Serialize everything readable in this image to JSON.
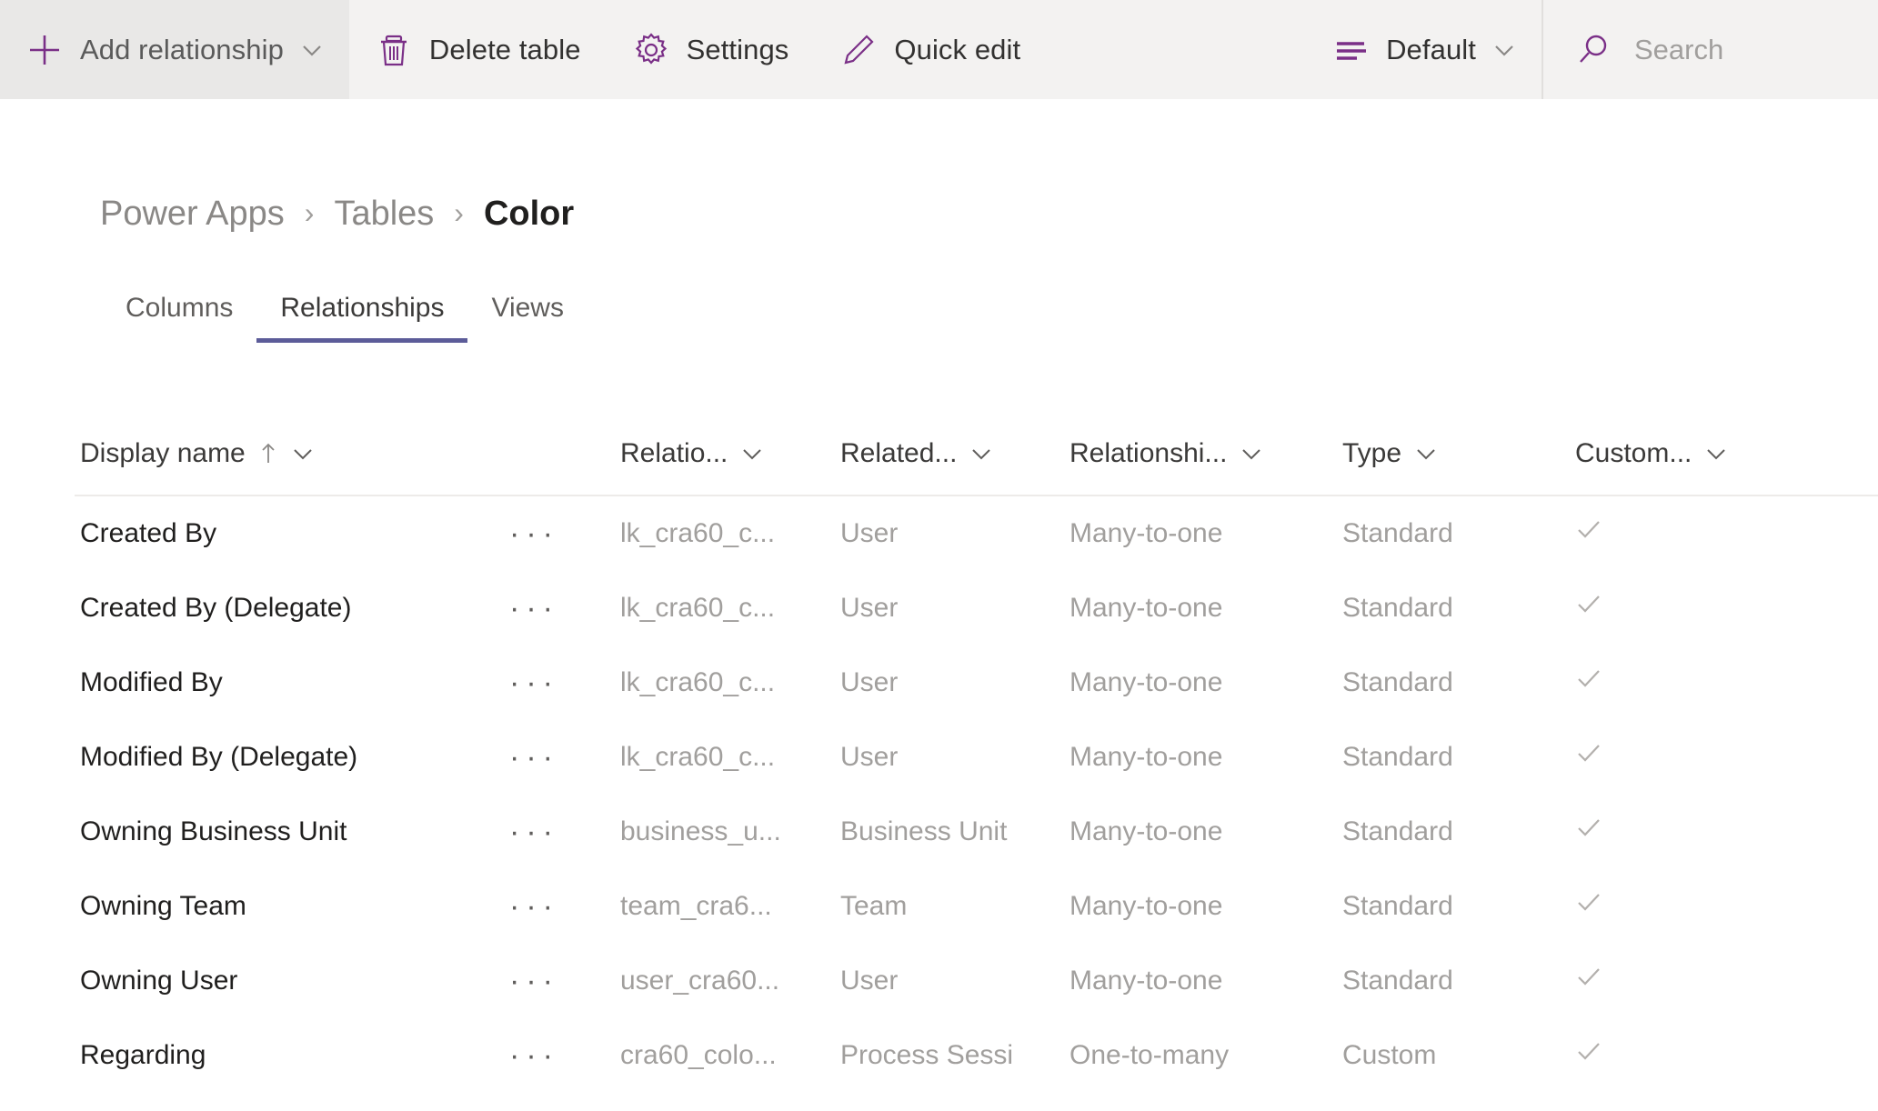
{
  "colors": {
    "brand_purple": "#7a2f87",
    "tab_underline": "#5c5c99",
    "commandbar_bg": "#f3f2f1",
    "highlight_bg": "#e9e8e7",
    "text_primary": "#201f1e",
    "text_dim": "#a19f9d"
  },
  "commandbar": {
    "add_relationship": {
      "label": "Add relationship",
      "icon": "plus-icon",
      "chevron": "chevron-down-icon"
    },
    "delete_table": {
      "label": "Delete table",
      "icon": "trash-icon"
    },
    "settings": {
      "label": "Settings",
      "icon": "gear-icon"
    },
    "quick_edit": {
      "label": "Quick edit",
      "icon": "pencil-icon"
    },
    "view_selector": {
      "label": "Default",
      "icon": "list-view-icon",
      "chevron": "chevron-down-icon"
    },
    "search": {
      "placeholder": "Search",
      "icon": "search-icon",
      "value": ""
    }
  },
  "breadcrumb": {
    "items": [
      "Power Apps",
      "Tables",
      "Color"
    ],
    "separator": "›"
  },
  "tabs": [
    {
      "label": "Columns",
      "active": false
    },
    {
      "label": "Relationships",
      "active": true
    },
    {
      "label": "Views",
      "active": false
    }
  ],
  "grid": {
    "sort": {
      "column": "Display name",
      "direction": "ascending",
      "glyph": "↑"
    },
    "columns": [
      {
        "key": "display_name",
        "label": "Display name",
        "sortable": true,
        "has_chevron": true
      },
      {
        "key": "menu",
        "label": "",
        "sortable": false,
        "has_chevron": false
      },
      {
        "key": "relationship_name",
        "label": "Relatio...",
        "sortable": false,
        "has_chevron": true
      },
      {
        "key": "related_table",
        "label": "Related...",
        "sortable": false,
        "has_chevron": true
      },
      {
        "key": "relationship_type",
        "label": "Relationshi...",
        "sortable": false,
        "has_chevron": true
      },
      {
        "key": "type",
        "label": "Type",
        "sortable": false,
        "has_chevron": true
      },
      {
        "key": "customizable",
        "label": "Custom...",
        "sortable": false,
        "has_chevron": true
      }
    ],
    "row_menu_glyph": "···",
    "rows": [
      {
        "display_name": "Created By",
        "relationship_name": "lk_cra60_c...",
        "related_table": "User",
        "relationship_type": "Many-to-one",
        "type": "Standard",
        "customizable": true
      },
      {
        "display_name": "Created By (Delegate)",
        "relationship_name": "lk_cra60_c...",
        "related_table": "User",
        "relationship_type": "Many-to-one",
        "type": "Standard",
        "customizable": true
      },
      {
        "display_name": "Modified By",
        "relationship_name": "lk_cra60_c...",
        "related_table": "User",
        "relationship_type": "Many-to-one",
        "type": "Standard",
        "customizable": true
      },
      {
        "display_name": "Modified By (Delegate)",
        "relationship_name": "lk_cra60_c...",
        "related_table": "User",
        "relationship_type": "Many-to-one",
        "type": "Standard",
        "customizable": true
      },
      {
        "display_name": "Owning Business Unit",
        "relationship_name": "business_u...",
        "related_table": "Business Unit",
        "relationship_type": "Many-to-one",
        "type": "Standard",
        "customizable": true
      },
      {
        "display_name": "Owning Team",
        "relationship_name": "team_cra6...",
        "related_table": "Team",
        "relationship_type": "Many-to-one",
        "type": "Standard",
        "customizable": true
      },
      {
        "display_name": "Owning User",
        "relationship_name": "user_cra60...",
        "related_table": "User",
        "relationship_type": "Many-to-one",
        "type": "Standard",
        "customizable": true
      },
      {
        "display_name": "Regarding",
        "relationship_name": "cra60_colo...",
        "related_table": "Process Sessi",
        "relationship_type": "One-to-many",
        "type": "Custom",
        "customizable": true
      }
    ]
  }
}
